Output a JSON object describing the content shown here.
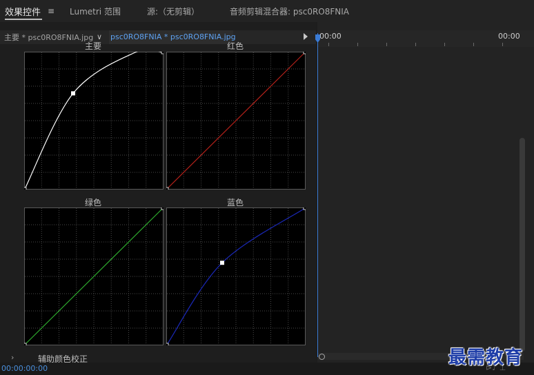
{
  "tabs": [
    {
      "label": "效果控件",
      "active": true
    },
    {
      "label": "Lumetri 范围",
      "active": false
    },
    {
      "label": "源:（无剪辑）",
      "active": false
    },
    {
      "label": "音频剪辑混合器: psc0RO8FNIA",
      "active": false
    }
  ],
  "menu_icon": "≡",
  "clipbar": {
    "master_clip": "主要 * psc0RO8FNIA.jpg",
    "dropdown_glyph": "∨",
    "sequence_clip": "psc0RO8FNIA * psc0RO8FNIA.jpg"
  },
  "curves": {
    "master": {
      "label": "主要",
      "color": "#ffffff",
      "points": [
        [
          0,
          0
        ],
        [
          0.35,
          0.7
        ],
        [
          0.8,
          1
        ],
        [
          1,
          1
        ]
      ],
      "handle": [
        0.35,
        0.7
      ]
    },
    "red": {
      "label": "红色",
      "color": "#b3211a",
      "points": [
        [
          0,
          0
        ],
        [
          1,
          1
        ]
      ]
    },
    "green": {
      "label": "绿色",
      "color": "#2fae2f",
      "points": [
        [
          0,
          0
        ],
        [
          1,
          1
        ]
      ]
    },
    "blue": {
      "label": "蓝色",
      "color": "#1a28b8",
      "points": [
        [
          0,
          0
        ],
        [
          0.4,
          0.6
        ],
        [
          1,
          1
        ]
      ],
      "handle": [
        0.4,
        0.6
      ]
    }
  },
  "aux_section": {
    "chevron": "›",
    "label": "辅助颜色校正"
  },
  "timecode": "00:00:00:00",
  "timeline": {
    "tc_start": "00:00",
    "tc_end": "00:00"
  },
  "bottom_icons": "⊳♪ ⊥",
  "watermark": "最需教育"
}
